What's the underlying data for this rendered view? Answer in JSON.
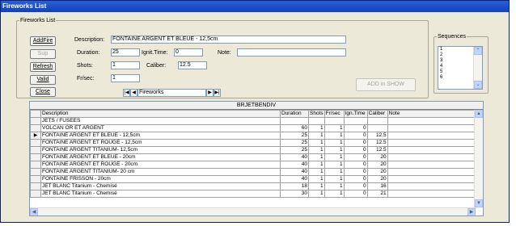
{
  "window": {
    "title": "Fireworks List"
  },
  "group": {
    "legend": "Fireworks List"
  },
  "buttons": {
    "add_fire": "AddFire",
    "sup": "Sup",
    "refresh": "Refresh",
    "valid": "Valid",
    "close": "Close"
  },
  "form": {
    "description_label": "Description:",
    "description_value": "FONTAINE ARGENT ET BLEUE - 12,5cm",
    "duration_label": "Duration:",
    "duration_value": "25",
    "ignit_label": "Ignit.Time:",
    "ignit_value": "0",
    "note_label": "Note:",
    "note_value": "",
    "shots_label": "Shots:",
    "shots_value": "1",
    "caliber_label": "Caliber:",
    "caliber_value": "12.5",
    "frsec_label": "Fr/sec:",
    "frsec_value": "1"
  },
  "navigator": {
    "first": "|◀",
    "prev": "◀",
    "text": "Fireworks",
    "next": "▶",
    "last": "▶|"
  },
  "add_show_label": "ADD in SHOW",
  "sequences": {
    "legend": "Sequences",
    "items": [
      "1",
      "2",
      "3",
      "4",
      "5",
      "6"
    ]
  },
  "grid": {
    "caption": "BRJETBENDIV",
    "columns": [
      "",
      "Description",
      "Duration",
      "Shots",
      "Fr/sec",
      "Ign.Time",
      "Caliber",
      "Note"
    ],
    "rows": [
      [
        "",
        "JETS / FUSEES",
        "",
        "",
        "",
        "",
        "",
        ""
      ],
      [
        "",
        "VOLCAN OR ET ARGENT",
        "60",
        "1",
        "1",
        "0",
        "",
        ""
      ],
      [
        "▶",
        "FONTAINE ARGENT ET BLEUE - 12,5cm",
        "25",
        "1",
        "1",
        "0",
        "12.5",
        ""
      ],
      [
        "",
        "FONTAINE ARGENT ET ROUGE - 12,5cm",
        "25",
        "1",
        "1",
        "0",
        "12.5",
        ""
      ],
      [
        "",
        "FONTAINE ARGENT TITANIUM- 12,5cm",
        "25",
        "1",
        "1",
        "0",
        "12.5",
        ""
      ],
      [
        "",
        "FONTAINE ARGENT ET BLEUE - 20cm",
        "40",
        "1",
        "1",
        "0",
        "20",
        ""
      ],
      [
        "",
        "FONTAINE ARGENT ET ROUGE - 20cm",
        "40",
        "1",
        "1",
        "0",
        "20",
        ""
      ],
      [
        "",
        "FONTAINE ARGENT TITANIUM- 20 cm",
        "40",
        "1",
        "1",
        "0",
        "20",
        ""
      ],
      [
        "",
        "FONTAINE FRISSON - 20cm",
        "40",
        "1",
        "1",
        "0",
        "20",
        ""
      ],
      [
        "",
        "JET BLANC Titanium - Chemisé",
        "18",
        "1",
        "1",
        "0",
        "16",
        ""
      ],
      [
        "",
        "JET BLANC Titanium - Chemisé",
        "30",
        "1",
        "1",
        "0",
        "21",
        ""
      ]
    ]
  },
  "scroll_glyphs": {
    "up": "▲",
    "down": "▼",
    "left": "◀",
    "right": "▶",
    "seq_up": "⌃",
    "seq_down": "⌄"
  }
}
